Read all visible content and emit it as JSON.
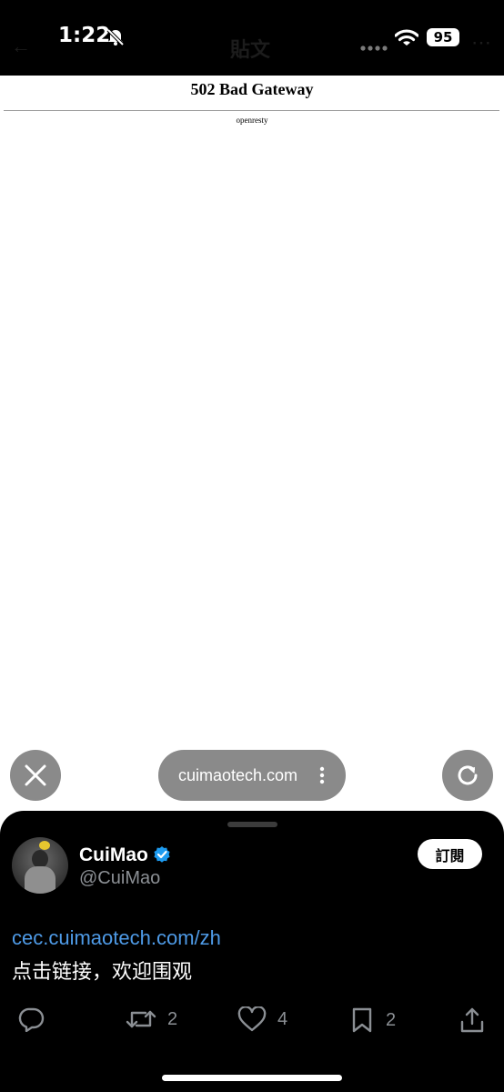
{
  "status_bar": {
    "time": "1:22",
    "battery": "95",
    "background_title": "貼文"
  },
  "page": {
    "error_title": "502 Bad Gateway",
    "server": "openresty"
  },
  "browser": {
    "url": "cuimaotech.com"
  },
  "sheet": {
    "display_name": "CuiMao",
    "handle": "@CuiMao",
    "subscribe_label": "訂閱",
    "link": "cec.cuimaotech.com/zh",
    "text": "点击链接，欢迎围观",
    "actions": {
      "repost_count": "2",
      "like_count": "4",
      "bookmark_count": "2"
    }
  },
  "colors": {
    "link": "#4e9ae6",
    "verified": "#1d9bf0",
    "muted": "#8b8f94"
  }
}
